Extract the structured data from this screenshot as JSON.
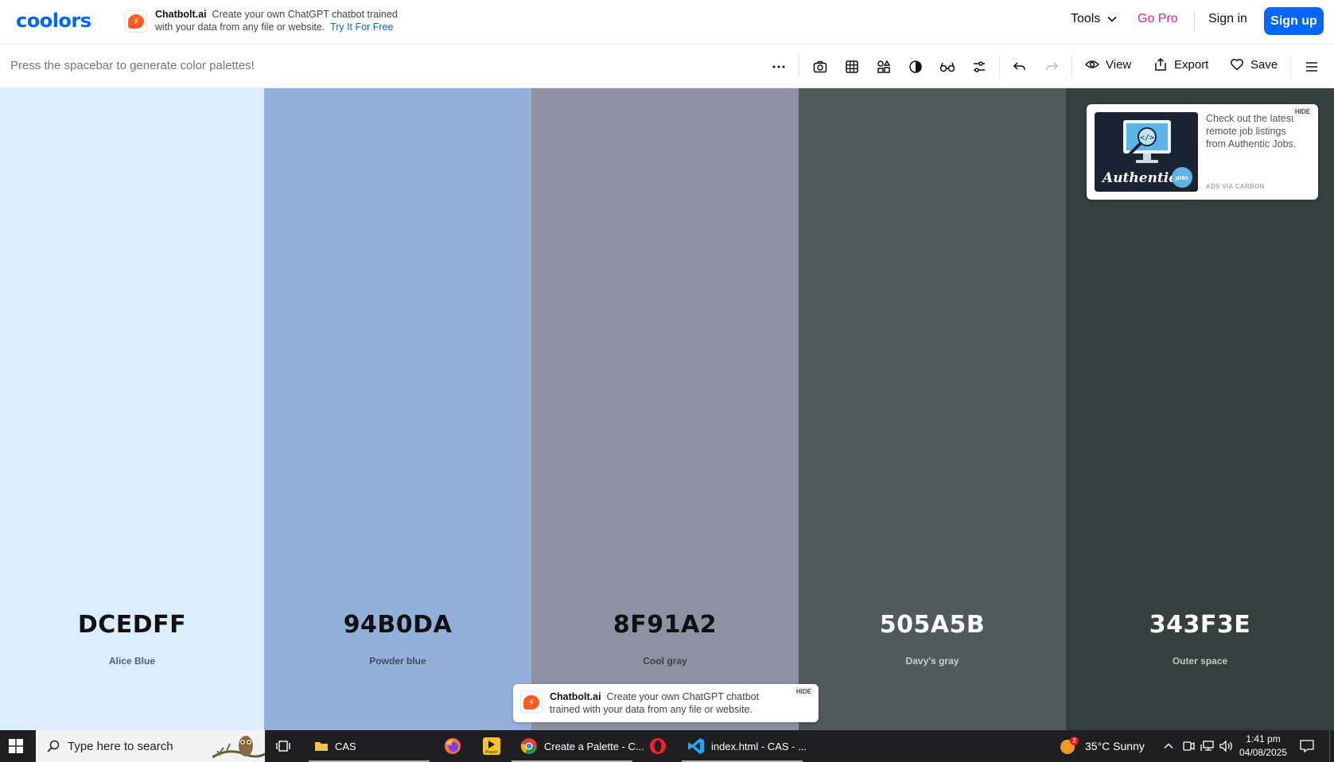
{
  "brand": {
    "logo": "coolors"
  },
  "top_ad": {
    "name": "Chatbolt.ai",
    "body": "Create your own ChatGPT chatbot trained with your data from any file or website.",
    "cta": "Try It For Free",
    "logo_char": "⚡"
  },
  "nav": {
    "tools": "Tools",
    "gopro": "Go Pro",
    "signin": "Sign in",
    "signup": "Sign up"
  },
  "toolbar": {
    "hint": "Press the spacebar to generate color palettes!",
    "view": "View",
    "export": "Export",
    "save": "Save"
  },
  "palette": [
    {
      "hex": "DCEDFF",
      "name": "Alice Blue",
      "bg": "#DCEDFF",
      "text": "#111111",
      "sub": "#556070"
    },
    {
      "hex": "94B0DA",
      "name": "Powder blue",
      "bg": "#94B0DA",
      "text": "#111111",
      "sub": "#3f4c60"
    },
    {
      "hex": "8F91A2",
      "name": "Cool gray",
      "bg": "#8F91A2",
      "text": "#111111",
      "sub": "#3e3f48"
    },
    {
      "hex": "505A5B",
      "name": "Davy's gray",
      "bg": "#505A5B",
      "text": "#ffffff",
      "sub": "#c9cdce"
    },
    {
      "hex": "343F3E",
      "name": "Outer space",
      "bg": "#343F3E",
      "text": "#ffffff",
      "sub": "#c3c8c7"
    }
  ],
  "carbon_ad": {
    "text": "Check out the latest remote job listings from Authentic Jobs.",
    "via": "ADS VIA CARBON",
    "hide": "HIDE",
    "img_brand": "Authentic",
    "img_badge": "JOBS"
  },
  "bottom_ad": {
    "name": "Chatbolt.ai",
    "body": "Create your own ChatGPT chatbot trained with your data from any file or website.",
    "hide": "HIDE"
  },
  "taskbar": {
    "search_placeholder": "Type here to search",
    "apps": [
      {
        "label": "CAS"
      },
      {
        "label": "Create a Palette - C..."
      },
      {
        "label": "index.html - CAS - ..."
      }
    ],
    "player_label": "Player",
    "weather": "35°C  Sunny",
    "weather_badge": "2",
    "time": "1:41 pm",
    "date": "04/08/2025"
  },
  "colors": {
    "accent": "#0066ff",
    "gopro": "#ea1e8c",
    "taskbar": "#1f1f22"
  }
}
